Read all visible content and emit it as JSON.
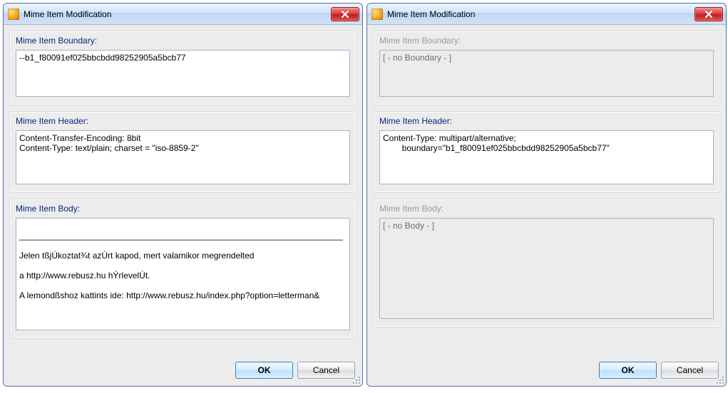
{
  "left": {
    "title": "Mime Item Modification",
    "groups": {
      "boundary": {
        "label": "Mime Item Boundary:",
        "value": "--b1_f80091ef025bbcbdd98252905a5bcb77",
        "enabled": true
      },
      "header": {
        "label": "Mime Item Header:",
        "value": "Content-Transfer-Encoding: 8bit\nContent-Type: text/plain; charset = \"iso-8859-2\"",
        "enabled": true
      },
      "body": {
        "label": "Mime Item Body:",
        "value": "\n____________________________________________________________________\n\nJelen tßjÚkoztat¾t azÚrt kapod, mert valamikor megrendelted\n\na http://www.rebusz.hu hÝrlevelÚt.\n\nA lemondßshoz kattints ide: http://www.rebusz.hu/index.php?option=letterman&",
        "enabled": true
      }
    },
    "buttons": {
      "ok": "OK",
      "cancel": "Cancel"
    }
  },
  "right": {
    "title": "Mime Item Modification",
    "groups": {
      "boundary": {
        "label": "Mime Item Boundary:",
        "value": "[ - no Boundary - ]",
        "enabled": false
      },
      "header": {
        "label": "Mime Item Header:",
        "value": "Content-Type: multipart/alternative;\n\tboundary=\"b1_f80091ef025bbcbdd98252905a5bcb77\"",
        "enabled": true
      },
      "body": {
        "label": "Mime Item Body:",
        "value": "[ - no Body - ]",
        "enabled": false
      }
    },
    "buttons": {
      "ok": "OK",
      "cancel": "Cancel"
    }
  }
}
